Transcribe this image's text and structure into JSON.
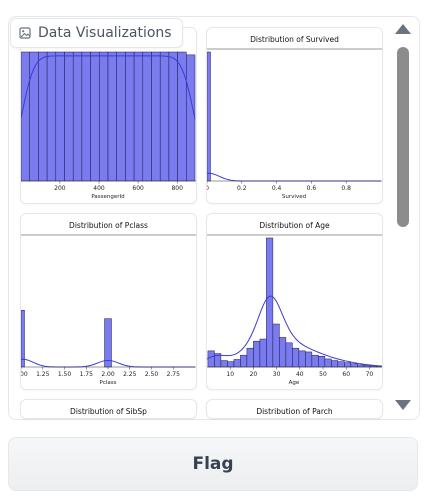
{
  "gallery": {
    "label": "Data Visualizations",
    "icon": "image-icon"
  },
  "button": {
    "flag": "Flag"
  },
  "colors": {
    "bar": "#7b7bf0",
    "bar_edge": "#1a1a4a",
    "kde": "#3b3bd6"
  },
  "chart_data": [
    {
      "type": "bar",
      "title": "",
      "xlabel": "PassengerId",
      "xticks": [
        "200",
        "400",
        "600",
        "800"
      ],
      "xlim": [
        1,
        891
      ],
      "bins": [
        1,
        45.5,
        90,
        134.5,
        179,
        223.5,
        268,
        312.5,
        357,
        401.5,
        446,
        490.5,
        535,
        579.5,
        624,
        668.5,
        713,
        757.5,
        802,
        846.5,
        891
      ],
      "values": [
        45,
        45,
        45,
        45,
        45,
        45,
        45,
        45,
        45,
        45,
        45,
        45,
        45,
        45,
        45,
        45,
        45,
        45,
        45,
        44
      ],
      "ylim": [
        0,
        45
      ],
      "kde": true
    },
    {
      "type": "bar",
      "title": "Distribution of Survived",
      "xlabel": "Survived",
      "xticks": [
        "0",
        "0.2",
        "0.4",
        "0.6",
        "0.8"
      ],
      "xlim": [
        0,
        1
      ],
      "bins": [
        0,
        0.02
      ],
      "values": [
        549
      ],
      "ylim": [
        0,
        549
      ],
      "kde": true
    },
    {
      "type": "bar",
      "title": "Distribution of Pclass",
      "xlabel": "Pclass",
      "xticks": [
        "1.00",
        "1.25",
        "1.50",
        "1.75",
        "2.00",
        "2.25",
        "2.50",
        "2.75"
      ],
      "xlim": [
        1,
        3
      ],
      "bins": [
        1,
        1.04,
        1.96,
        2.04
      ],
      "values": [
        216,
        0,
        184
      ],
      "ylim": [
        0,
        491
      ],
      "kde": true
    },
    {
      "type": "bar",
      "title": "Distribution of Age",
      "xlabel": "Age",
      "xticks": [
        "10",
        "20",
        "30",
        "40",
        "50",
        "60",
        "70"
      ],
      "xlim": [
        0,
        75
      ],
      "bins": [
        0.4,
        3.2,
        6,
        8.8,
        11.6,
        14.4,
        17.2,
        20,
        22.8,
        25.6,
        28.4,
        31.2,
        34,
        36.8,
        39.6,
        42.4,
        45.2,
        48,
        50.8,
        53.6,
        56.4,
        59.2,
        62,
        64.8,
        67.6,
        70.4,
        73.2,
        76
      ],
      "values": [
        30,
        25,
        12,
        10,
        14,
        22,
        35,
        48,
        52,
        240,
        80,
        55,
        45,
        35,
        30,
        28,
        22,
        20,
        15,
        12,
        10,
        8,
        6,
        4,
        3,
        2,
        2
      ],
      "ylim": [
        0,
        240
      ],
      "kde": true
    },
    {
      "type": "bar",
      "title": "Distribution of SibSp"
    },
    {
      "type": "bar",
      "title": "Distribution of Parch"
    }
  ]
}
